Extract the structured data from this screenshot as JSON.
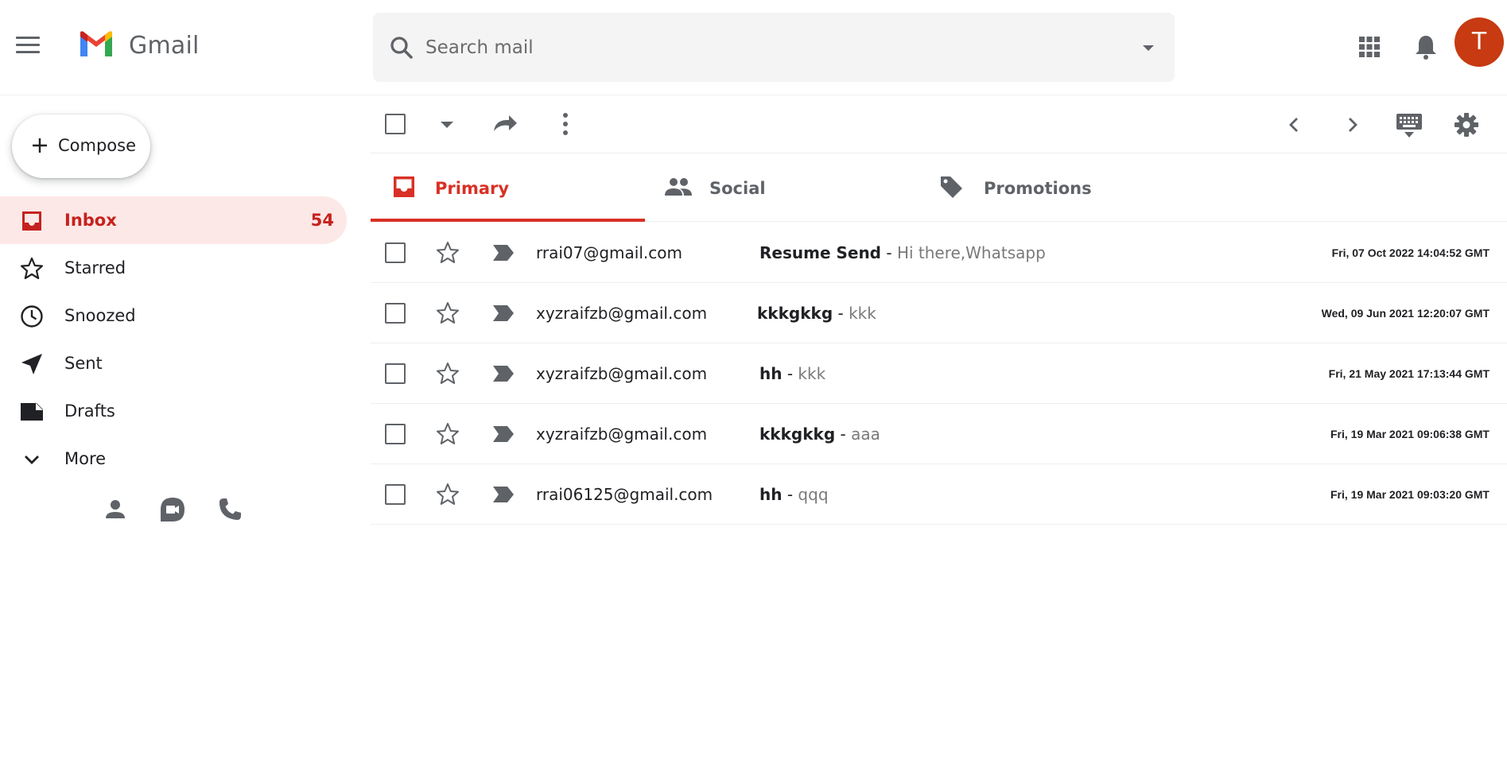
{
  "header": {
    "brand": "Gmail",
    "search_placeholder": "Search mail",
    "avatar_letter": "T"
  },
  "colors": {
    "accent_red": "#d93025",
    "active_bg": "#fce8e6",
    "avatar_bg": "#c73a12"
  },
  "sidebar": {
    "compose_label": "Compose",
    "items": [
      {
        "label": "Inbox",
        "count": "54",
        "icon": "inbox-icon",
        "active": true
      },
      {
        "label": "Starred",
        "count": "",
        "icon": "star-icon"
      },
      {
        "label": "Snoozed",
        "count": "",
        "icon": "clock-icon"
      },
      {
        "label": "Sent",
        "count": "",
        "icon": "send-icon"
      },
      {
        "label": "Drafts",
        "count": "",
        "icon": "draft-icon"
      },
      {
        "label": "More",
        "count": "",
        "icon": "chevron-down-icon"
      }
    ],
    "bottom_icons": [
      "person-icon",
      "video-icon",
      "phone-icon"
    ]
  },
  "toolbar": {
    "icons": [
      "select-all-checkbox",
      "select-dropdown-icon",
      "refresh-icon",
      "more-vert-icon",
      "prev-page-icon",
      "next-page-icon",
      "keyboard-icon",
      "settings-icon"
    ]
  },
  "tabs": [
    {
      "label": "Primary",
      "icon": "inbox-icon",
      "active": true
    },
    {
      "label": "Social",
      "icon": "people-icon"
    },
    {
      "label": "Promotions",
      "icon": "tag-icon"
    }
  ],
  "messages": [
    {
      "sender": "rrai07@gmail.com",
      "subject": "Resume Send",
      "snippet": "Hi there,Whatsapp",
      "date": "Fri, 07 Oct 2022 14:04:52 GMT"
    },
    {
      "sender": "xyzraifzb@gmail.com",
      "subject": "kkkgkkg",
      "snippet": "kkk",
      "date": "Wed, 09 Jun 2021 12:20:07 GMT"
    },
    {
      "sender": "xyzraifzb@gmail.com",
      "subject": "hh",
      "snippet": "kkk",
      "date": "Fri, 21 May 2021 17:13:44 GMT"
    },
    {
      "sender": "xyzraifzb@gmail.com",
      "subject": "kkkgkkg",
      "snippet": "aaa",
      "date": "Fri, 19 Mar 2021 09:06:38 GMT"
    },
    {
      "sender": "rrai06125@gmail.com",
      "subject": "hh",
      "snippet": "qqq",
      "date": "Fri, 19 Mar 2021 09:03:20 GMT"
    }
  ]
}
